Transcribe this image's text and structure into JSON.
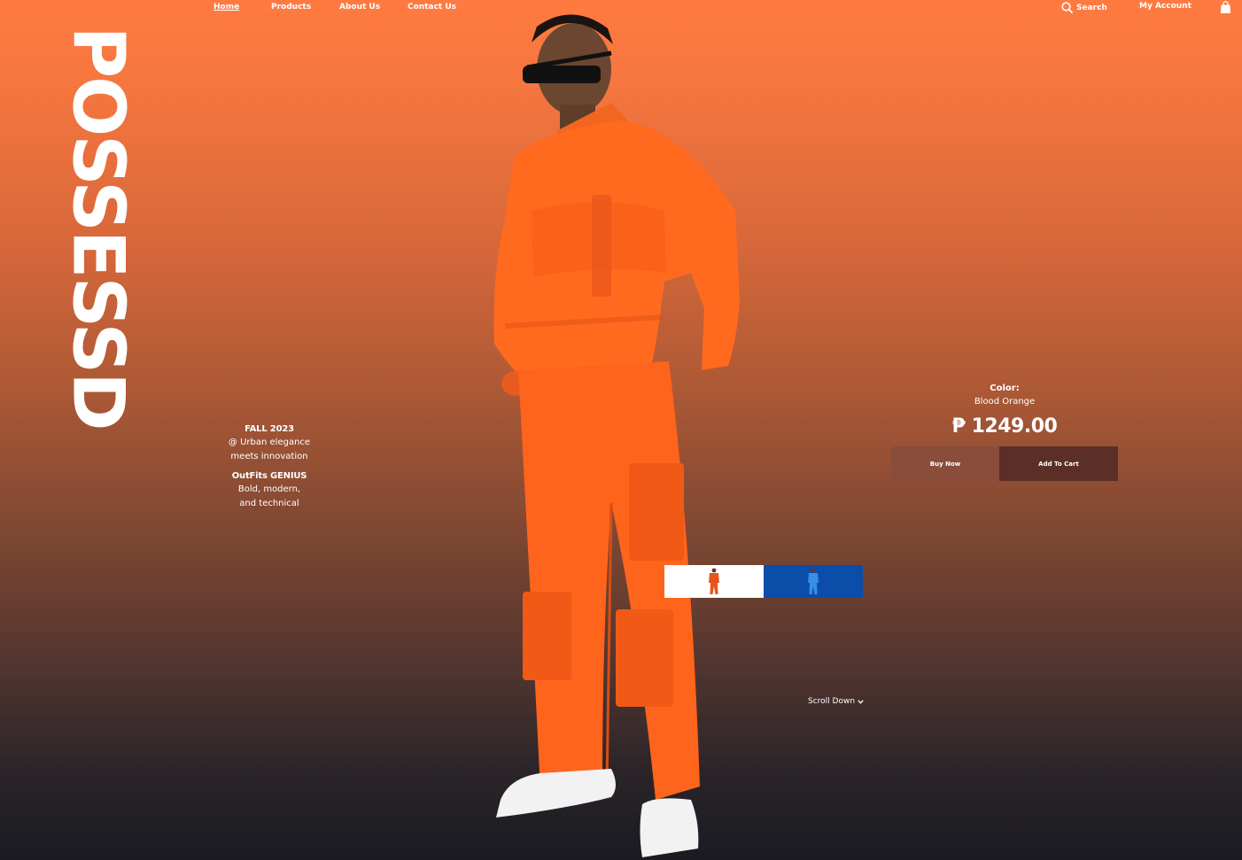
{
  "nav": {
    "links": [
      {
        "label": "Home"
      },
      {
        "label": "Products"
      },
      {
        "label": "About Us"
      },
      {
        "label": "Contact Us"
      }
    ],
    "search_label": "Search",
    "account_label": "My Account",
    "icons": [
      "search-icon",
      "shopping-bag-icon"
    ]
  },
  "brand": {
    "name": "POSSESSD"
  },
  "intro": {
    "season": "FALL 2023",
    "tagline_line1": "@ Urban elegance",
    "tagline_line2": "meets innovation",
    "collection": "OutFits GENIUS",
    "desc_line1": "Bold, modern,",
    "desc_line2": "and technical"
  },
  "product": {
    "color_label": "Color:",
    "color_value": "Blood Orange",
    "price": "₱ 1249.00",
    "buy_label": "Buy Now",
    "cart_label": "Add To Cart"
  },
  "swatches": [
    {
      "name": "Blood Orange",
      "bg": "#ffffff",
      "figure_color": "#e8541a"
    },
    {
      "name": "Blue",
      "bg": "#0b4eaa",
      "figure_color": "#3a8ee8"
    }
  ],
  "scroll": {
    "label": "Scroll Down",
    "icon": "chevron-down-icon"
  },
  "colors": {
    "gradient_top": "#ff7a41",
    "gradient_bottom": "#1a1b22",
    "outfit": "#ff6a1f",
    "buy_button": "#8a4d3c",
    "cart_button": "#5b2f25"
  }
}
